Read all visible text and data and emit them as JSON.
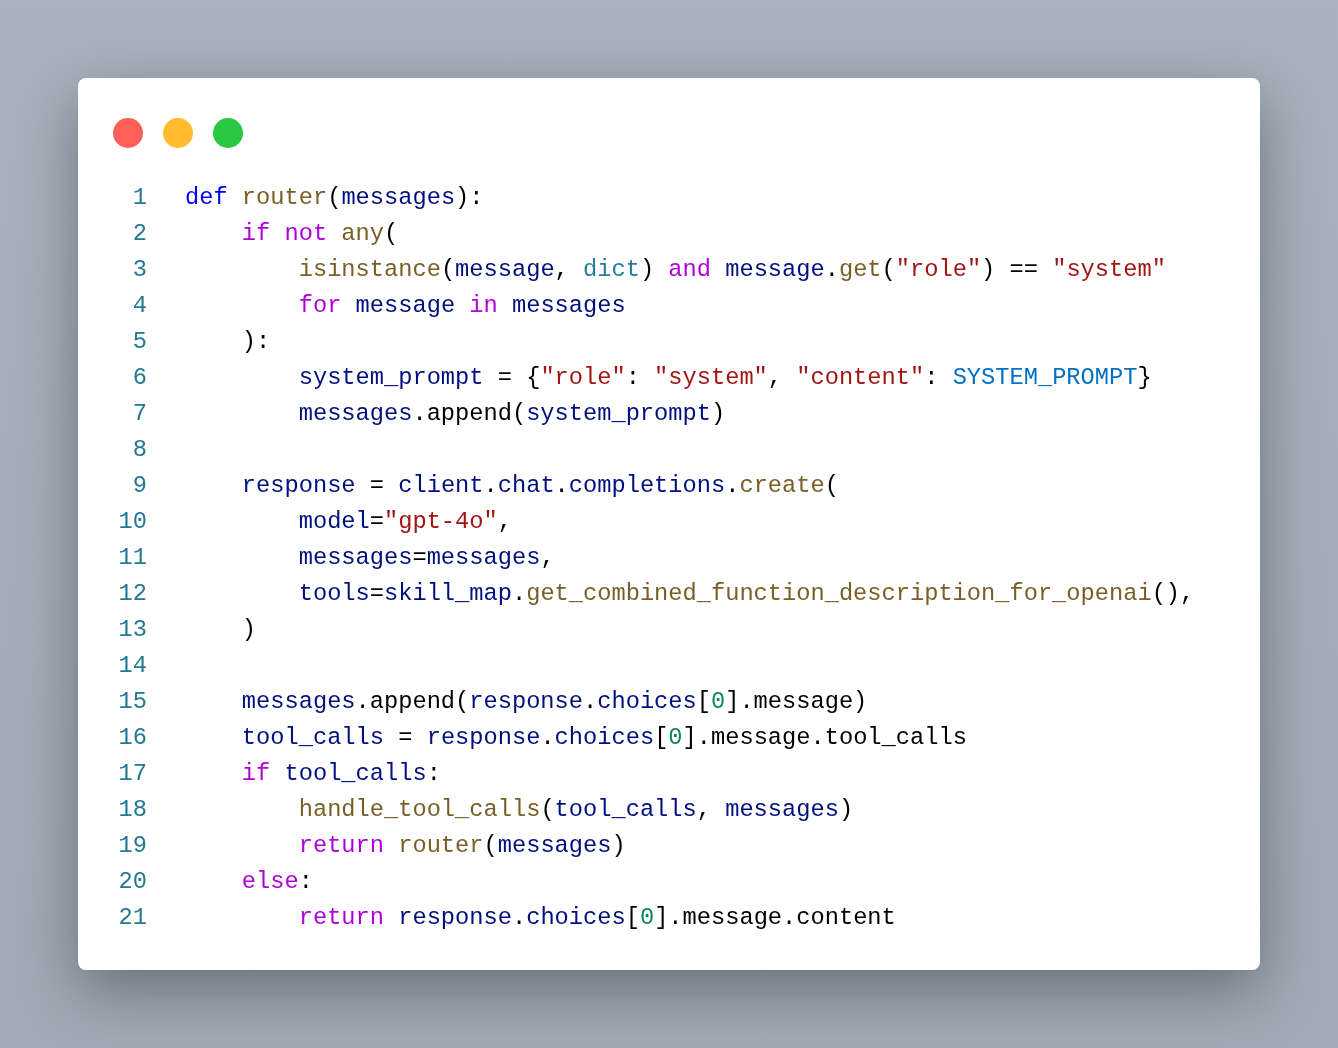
{
  "code": {
    "lines": [
      {
        "number": "1",
        "tokens": [
          {
            "kind": "kw",
            "text": "def"
          },
          {
            "kind": "fn",
            "text": " router"
          },
          {
            "kind": "op",
            "text": "("
          },
          {
            "kind": "var",
            "text": "messages"
          },
          {
            "kind": "op",
            "text": "):"
          }
        ]
      },
      {
        "number": "2",
        "tokens": [
          {
            "kind": "ctl",
            "text": "    if"
          },
          {
            "kind": "ctl",
            "text": " not"
          },
          {
            "kind": "fn",
            "text": " any"
          },
          {
            "kind": "op",
            "text": "("
          }
        ]
      },
      {
        "number": "3",
        "tokens": [
          {
            "kind": "fn",
            "text": "        isinstance"
          },
          {
            "kind": "op",
            "text": "("
          },
          {
            "kind": "var",
            "text": "message"
          },
          {
            "kind": "op",
            "text": ", "
          },
          {
            "kind": "type",
            "text": "dict"
          },
          {
            "kind": "op",
            "text": ") "
          },
          {
            "kind": "ctl",
            "text": "and"
          },
          {
            "kind": "var",
            "text": " message"
          },
          {
            "kind": "op",
            "text": "."
          },
          {
            "kind": "fn",
            "text": "get"
          },
          {
            "kind": "op",
            "text": "("
          },
          {
            "kind": "str",
            "text": "\"role\""
          },
          {
            "kind": "op",
            "text": ") == "
          },
          {
            "kind": "str",
            "text": "\"system\""
          }
        ]
      },
      {
        "number": "4",
        "tokens": [
          {
            "kind": "ctl",
            "text": "        for"
          },
          {
            "kind": "var",
            "text": " message"
          },
          {
            "kind": "ctl",
            "text": " in"
          },
          {
            "kind": "var",
            "text": " messages"
          }
        ]
      },
      {
        "number": "5",
        "tokens": [
          {
            "kind": "op",
            "text": "    ):"
          }
        ]
      },
      {
        "number": "6",
        "tokens": [
          {
            "kind": "var",
            "text": "        system_prompt"
          },
          {
            "kind": "op",
            "text": " = {"
          },
          {
            "kind": "str",
            "text": "\"role\""
          },
          {
            "kind": "op",
            "text": ": "
          },
          {
            "kind": "str",
            "text": "\"system\""
          },
          {
            "kind": "op",
            "text": ", "
          },
          {
            "kind": "str",
            "text": "\"content\""
          },
          {
            "kind": "op",
            "text": ": "
          },
          {
            "kind": "const",
            "text": "SYSTEM_PROMPT"
          },
          {
            "kind": "op",
            "text": "}"
          }
        ]
      },
      {
        "number": "7",
        "tokens": [
          {
            "kind": "var",
            "text": "        messages"
          },
          {
            "kind": "op",
            "text": ".append("
          },
          {
            "kind": "var",
            "text": "system_prompt"
          },
          {
            "kind": "op",
            "text": ")"
          }
        ]
      },
      {
        "number": "8"
      },
      {
        "number": "9",
        "tokens": [
          {
            "kind": "var",
            "text": "    response"
          },
          {
            "kind": "op",
            "text": " = "
          },
          {
            "kind": "var",
            "text": "client"
          },
          {
            "kind": "op",
            "text": "."
          },
          {
            "kind": "var",
            "text": "chat"
          },
          {
            "kind": "op",
            "text": "."
          },
          {
            "kind": "var",
            "text": "completions"
          },
          {
            "kind": "op",
            "text": "."
          },
          {
            "kind": "fn",
            "text": "create"
          },
          {
            "kind": "op",
            "text": "("
          }
        ]
      },
      {
        "number": "10",
        "tokens": [
          {
            "kind": "var",
            "text": "        model"
          },
          {
            "kind": "op",
            "text": "="
          },
          {
            "kind": "str",
            "text": "\"gpt-4o\""
          },
          {
            "kind": "op",
            "text": ","
          }
        ]
      },
      {
        "number": "11",
        "tokens": [
          {
            "kind": "var",
            "text": "        messages"
          },
          {
            "kind": "op",
            "text": "="
          },
          {
            "kind": "var",
            "text": "messages"
          },
          {
            "kind": "op",
            "text": ","
          }
        ]
      },
      {
        "number": "12",
        "tokens": [
          {
            "kind": "var",
            "text": "        tools"
          },
          {
            "kind": "op",
            "text": "="
          },
          {
            "kind": "var",
            "text": "skill_map"
          },
          {
            "kind": "op",
            "text": "."
          },
          {
            "kind": "fn",
            "text": "get_combined_function_description_for_openai"
          },
          {
            "kind": "op",
            "text": "(),"
          }
        ]
      },
      {
        "number": "13",
        "tokens": [
          {
            "kind": "op",
            "text": "    )"
          }
        ]
      },
      {
        "number": "14"
      },
      {
        "number": "15",
        "tokens": [
          {
            "kind": "var",
            "text": "    messages"
          },
          {
            "kind": "op",
            "text": ".append("
          },
          {
            "kind": "var",
            "text": "response"
          },
          {
            "kind": "op",
            "text": "."
          },
          {
            "kind": "var",
            "text": "choices"
          },
          {
            "kind": "op",
            "text": "["
          },
          {
            "kind": "num",
            "text": "0"
          },
          {
            "kind": "op",
            "text": "].message)"
          }
        ]
      },
      {
        "number": "16",
        "tokens": [
          {
            "kind": "var",
            "text": "    tool_calls"
          },
          {
            "kind": "op",
            "text": " = "
          },
          {
            "kind": "var",
            "text": "response"
          },
          {
            "kind": "op",
            "text": "."
          },
          {
            "kind": "var",
            "text": "choices"
          },
          {
            "kind": "op",
            "text": "["
          },
          {
            "kind": "num",
            "text": "0"
          },
          {
            "kind": "op",
            "text": "].message.tool_calls"
          }
        ]
      },
      {
        "number": "17",
        "tokens": [
          {
            "kind": "ctl",
            "text": "    if"
          },
          {
            "kind": "var",
            "text": " tool_calls"
          },
          {
            "kind": "op",
            "text": ":"
          }
        ]
      },
      {
        "number": "18",
        "tokens": [
          {
            "kind": "fn",
            "text": "        handle_tool_calls"
          },
          {
            "kind": "op",
            "text": "("
          },
          {
            "kind": "var",
            "text": "tool_calls"
          },
          {
            "kind": "op",
            "text": ", "
          },
          {
            "kind": "var",
            "text": "messages"
          },
          {
            "kind": "op",
            "text": ")"
          }
        ]
      },
      {
        "number": "19",
        "tokens": [
          {
            "kind": "ctl",
            "text": "        return"
          },
          {
            "kind": "fn",
            "text": " router"
          },
          {
            "kind": "op",
            "text": "("
          },
          {
            "kind": "var",
            "text": "messages"
          },
          {
            "kind": "op",
            "text": ")"
          }
        ]
      },
      {
        "number": "20",
        "tokens": [
          {
            "kind": "ctl",
            "text": "    else"
          },
          {
            "kind": "op",
            "text": ":"
          }
        ]
      },
      {
        "number": "21",
        "tokens": [
          {
            "kind": "ctl",
            "text": "        return"
          },
          {
            "kind": "var",
            "text": " response"
          },
          {
            "kind": "op",
            "text": "."
          },
          {
            "kind": "var",
            "text": "choices"
          },
          {
            "kind": "op",
            "text": "["
          },
          {
            "kind": "num",
            "text": "0"
          },
          {
            "kind": "op",
            "text": "].message.content"
          }
        ]
      }
    ]
  }
}
